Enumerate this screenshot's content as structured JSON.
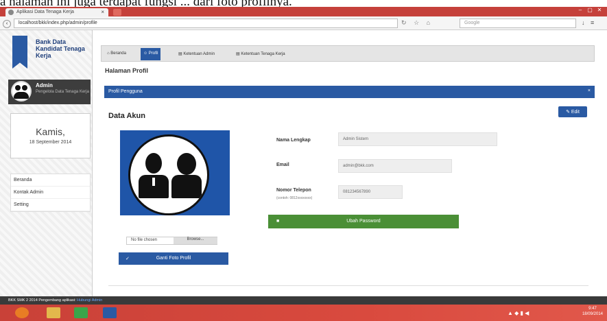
{
  "caption_top": "a halaman ini juga terdapat fungsi ... dari foto profilnya.",
  "browser": {
    "tab_title": "Aplikasi Data Tenaga Kerja",
    "url": "localhost/bkk/index.php/admin/profile",
    "search_placeholder": "Google",
    "window_controls": [
      "–",
      "▢",
      "✕"
    ]
  },
  "sidebar": {
    "logo_text": "Bank Data Kandidat Tenaga Kerja",
    "admin_name": "Admin",
    "admin_sub": "Pengelola Data Tenaga Kerja",
    "day": "Kamis,",
    "date": "18 September 2014",
    "menu": [
      "Beranda",
      "Kontak Admin",
      "Setting"
    ]
  },
  "main": {
    "tabs": [
      {
        "label": "Beranda"
      },
      {
        "label": "Profil"
      },
      {
        "label": "Ketentuan Admin"
      },
      {
        "label": "Ketentuan Tenaga Kerja"
      }
    ],
    "page_title": "Halaman Profil",
    "panel_title": "Profil Pengguna",
    "panel_close": "×",
    "section_title": "Data Akun",
    "edit_label": "✎ Edit",
    "file_input_text": "No file chosen",
    "browse_label": "Browse...",
    "upload_label": "Ganti Foto Profil",
    "fields": [
      {
        "label": "Nama Lengkap",
        "value": "Admin Sistem"
      },
      {
        "label": "Email",
        "value": "admin@bkk.com"
      },
      {
        "label": "Nomor Telepon",
        "sub": "(contoh: 0812xxxxxxxx)",
        "value": "081234567890"
      }
    ],
    "password_label": "Ubah Password"
  },
  "footer": {
    "text": "BKK SMK 2 2014 Pengembang aplikasi: ",
    "link": "Hubungi Admin"
  },
  "taskbar": {
    "time": "9:47",
    "date": "18/09/2014"
  }
}
